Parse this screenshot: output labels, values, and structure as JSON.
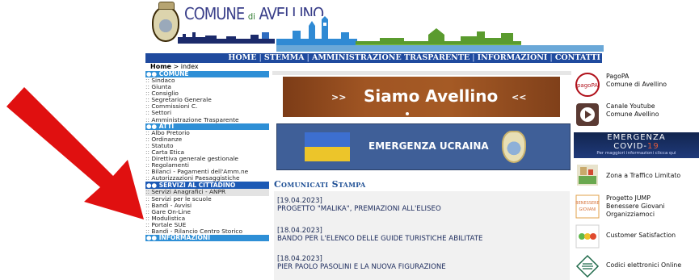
{
  "header": {
    "logo_part1": "COMUNE",
    "logo_part2": "di",
    "logo_part3": "AVELLINO"
  },
  "topnav": {
    "items": [
      {
        "label": "HOME"
      },
      {
        "label": "STEMMA"
      },
      {
        "label": "AMMINISTRAZIONE TRASPARENTE"
      },
      {
        "label": "INFORMAZIONI"
      },
      {
        "label": "CONTATTI"
      }
    ],
    "separator": "|"
  },
  "breadcrumb": {
    "home": "Home",
    "separator": " > ",
    "current": "index"
  },
  "sidebar": {
    "sections": [
      {
        "title": "COMUNE",
        "items": [
          "Sindaco",
          "Giunta",
          "Consiglio",
          "Segretario Generale",
          "Commissioni C.",
          "Settori",
          "Amministrazione Trasparente"
        ]
      },
      {
        "title": "ATTI",
        "items": [
          "Albo Pretorio",
          "Ordinanze",
          "Statuto",
          "Carta Etica",
          "Direttiva generale gestionale",
          "Regolamenti",
          "Bilanci - Pagamenti dell'Amm.ne",
          "Autorizzazioni Paesaggistiche"
        ]
      },
      {
        "title": "SERVIZI AL CITTADINO",
        "items": [
          "Servizi Anagrafici - ANPR",
          "Servizi per le scuole",
          "Bandi - Avvisi",
          "Gare On-Line",
          "Modulistica",
          "Portale SUE",
          "Bandi - Rilancio Centro Storico"
        ]
      },
      {
        "title": "INFORMAZIONI",
        "items": []
      }
    ],
    "item_prefix": ":: ",
    "section_prefix": "●● "
  },
  "center": {
    "banner1": {
      "title": "Siamo Avellino",
      "left_mark": ">>",
      "right_mark": "<<"
    },
    "banner2": {
      "title": "EMERGENZA UCRAINA"
    },
    "comunicati_title": "Comunicati Stampa",
    "news": [
      {
        "date": "[19.04.2023]",
        "headline": "PROGETTO \"MALIKA\", PREMIAZIONI ALL'ELISEO"
      },
      {
        "date": "[18.04.2023]",
        "headline": "BANDO PER L'ELENCO DELLE GUIDE TURISTICHE ABILITATE"
      },
      {
        "date": "[18.04.2023]",
        "headline": "PIER PAOLO PASOLINI E LA NUOVA FIGURAZIONE"
      }
    ]
  },
  "right": {
    "pagopa": {
      "line1": "PagoPA",
      "line2": "Comune di Avellino",
      "icon": "pagopa-icon",
      "icon_text": "pagoPA"
    },
    "youtube": {
      "line1": "Canale Youtube",
      "line2": "Comune Avellino",
      "icon": "youtube-play-icon"
    },
    "covid": {
      "line1": "EMERGENZA",
      "line2_prefix": "COVID-",
      "line2_num": "19",
      "line3": "Per maggiori informazioni clicca qui"
    },
    "ztl": {
      "line1": "Zona a Traffico Limitato",
      "icon": "traffic-zone-icon"
    },
    "jump": {
      "line1": "Progetto JUMP",
      "line2": "Benessere Giovani",
      "line3": "Organizziamoci",
      "icon": "benessere-giovani-icon",
      "icon_text_1": "BENESSERE",
      "icon_text_2": "GIOVANI"
    },
    "customer": {
      "line1": "Customer Satisfaction",
      "icon": "smiley-faces-icon"
    },
    "codici": {
      "line1": "Codici elettronici Online",
      "icon": "diamond-lines-icon"
    }
  },
  "colors": {
    "nav_bg": "#1f4a9e",
    "section_head": "#2e8fd6",
    "section_head_selected": "#1b59b5",
    "arrow": "#e01010",
    "comunicati_title": "#1d4e94"
  }
}
